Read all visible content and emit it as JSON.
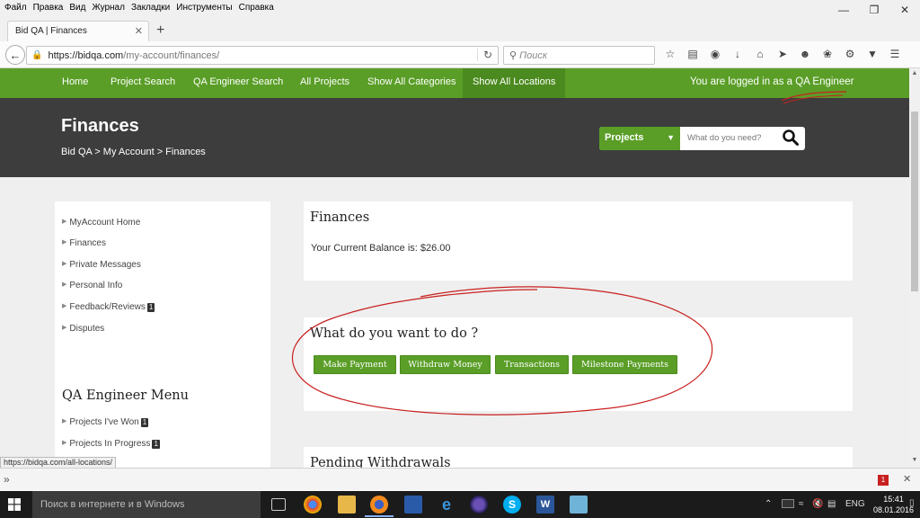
{
  "browser": {
    "menu": [
      "Файл",
      "Правка",
      "Вид",
      "Журнал",
      "Закладки",
      "Инструменты",
      "Справка"
    ],
    "tab_title": "Bid QA | Finances",
    "url_host": "https://bidqa.com",
    "url_path": "/my-account/finances/",
    "search_placeholder": "Поиск",
    "status_url": "https://bidqa.com/all-locations/"
  },
  "site_nav": {
    "items": [
      "Home",
      "Project Search",
      "QA Engineer Search",
      "All Projects",
      "Show All Categories",
      "Show All Locations"
    ],
    "logged_in_prefix": "You are logged in as a ",
    "logged_in_role": "QA Engineer"
  },
  "header": {
    "title": "Finances",
    "breadcrumb": "Bid QA > My Account > Finances",
    "search_select": "Projects",
    "search_placeholder": "What do you need?"
  },
  "sidebar": {
    "links": [
      {
        "label": "MyAccount Home",
        "badge": ""
      },
      {
        "label": "Finances",
        "badge": ""
      },
      {
        "label": "Private Messages",
        "badge": ""
      },
      {
        "label": "Personal Info",
        "badge": ""
      },
      {
        "label": "Feedback/Reviews",
        "badge": "1"
      },
      {
        "label": "Disputes",
        "badge": ""
      }
    ],
    "menu_heading": "QA Engineer Menu",
    "menu_links": [
      {
        "label": "Projects I've Won",
        "badge": "1"
      },
      {
        "label": "Projects In Progress",
        "badge": "1"
      }
    ]
  },
  "finances": {
    "title": "Finances",
    "balance_text": "Your Current Balance is: $26.00"
  },
  "actions": {
    "title": "What do you want to do ?",
    "buttons": [
      "Make Payment",
      "Withdraw Money",
      "Transactions",
      "Milestone Payments"
    ]
  },
  "pending": {
    "title": "Pending Withdrawals"
  },
  "taskbar": {
    "search_text": "Поиск в интернете и в Windows",
    "lang": "ENG",
    "time": "15:41",
    "date": "08.01.2016",
    "notification_count": "1"
  },
  "colors": {
    "green": "#5a9e27",
    "dark_header": "#3d3d3d",
    "annotation_red": "#c8201f"
  }
}
